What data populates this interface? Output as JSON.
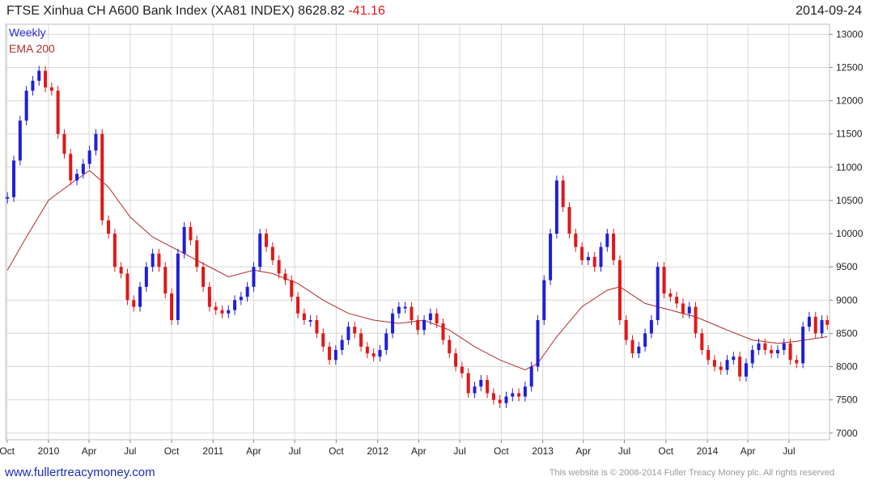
{
  "header": {
    "title": "FTSE Xinhua CH A600 Bank Index (XA81 INDEX) 8628.82",
    "change": "-41.16",
    "date": "2014-09-24"
  },
  "footer": {
    "site": "www.fullertreacymoney.com",
    "copyright": "This website is © 2008-2014 Fuller Treacy Money plc. All rights reserved"
  },
  "colors": {
    "up": "#1f1fd8",
    "down": "#e01818",
    "ema": "#b02a2a",
    "grid": "#d8d8d8"
  },
  "chart_data": {
    "type": "line",
    "legend": [
      "Weekly",
      "EMA 200"
    ],
    "legend_position": "top-left",
    "grid": true,
    "ylim": [
      6900,
      13150
    ],
    "xlim": [
      "2009-09-28",
      "2014-09-29"
    ],
    "y_ticks": [
      7000,
      7500,
      8000,
      8500,
      9000,
      9500,
      10000,
      10500,
      11000,
      11500,
      12000,
      12500,
      13000
    ],
    "x_ticks": [
      {
        "label": "Oct",
        "date": "2009-10-01"
      },
      {
        "label": "2010",
        "date": "2010-01-01"
      },
      {
        "label": "Apr",
        "date": "2010-04-01"
      },
      {
        "label": "Jul",
        "date": "2010-07-01"
      },
      {
        "label": "Oct",
        "date": "2010-10-01"
      },
      {
        "label": "2011",
        "date": "2011-01-01"
      },
      {
        "label": "Apr",
        "date": "2011-04-01"
      },
      {
        "label": "Jul",
        "date": "2011-07-01"
      },
      {
        "label": "Oct",
        "date": "2011-10-01"
      },
      {
        "label": "2012",
        "date": "2012-01-01"
      },
      {
        "label": "Apr",
        "date": "2012-04-01"
      },
      {
        "label": "Jul",
        "date": "2012-07-01"
      },
      {
        "label": "Oct",
        "date": "2012-10-01"
      },
      {
        "label": "2013",
        "date": "2013-01-01"
      },
      {
        "label": "Apr",
        "date": "2013-04-01"
      },
      {
        "label": "Jul",
        "date": "2013-07-01"
      },
      {
        "label": "Oct",
        "date": "2013-10-01"
      },
      {
        "label": "2014",
        "date": "2014-01-01"
      },
      {
        "label": "Apr",
        "date": "2014-04-01"
      },
      {
        "label": "Jul",
        "date": "2014-07-01"
      }
    ],
    "series": [
      {
        "name": "Weekly",
        "points": [
          [
            "2009-10-02",
            10550
          ],
          [
            "2009-10-16",
            11100
          ],
          [
            "2009-10-30",
            11700
          ],
          [
            "2009-11-13",
            12150
          ],
          [
            "2009-11-27",
            12300
          ],
          [
            "2009-12-11",
            12450
          ],
          [
            "2009-12-25",
            12200
          ],
          [
            "2010-01-08",
            12150
          ],
          [
            "2010-01-22",
            11500
          ],
          [
            "2010-02-05",
            11200
          ],
          [
            "2010-02-19",
            10800
          ],
          [
            "2010-03-05",
            10900
          ],
          [
            "2010-03-19",
            11050
          ],
          [
            "2010-04-02",
            11250
          ],
          [
            "2010-04-16",
            11500
          ],
          [
            "2010-04-30",
            10200
          ],
          [
            "2010-05-14",
            10000
          ],
          [
            "2010-05-28",
            9500
          ],
          [
            "2010-06-11",
            9400
          ],
          [
            "2010-06-25",
            9000
          ],
          [
            "2010-07-09",
            8900
          ],
          [
            "2010-07-23",
            9200
          ],
          [
            "2010-08-06",
            9500
          ],
          [
            "2010-08-20",
            9700
          ],
          [
            "2010-09-03",
            9500
          ],
          [
            "2010-09-17",
            9100
          ],
          [
            "2010-10-01",
            8700
          ],
          [
            "2010-10-15",
            9700
          ],
          [
            "2010-10-29",
            10100
          ],
          [
            "2010-11-12",
            9900
          ],
          [
            "2010-11-26",
            9500
          ],
          [
            "2010-12-10",
            9200
          ],
          [
            "2010-12-24",
            8900
          ],
          [
            "2011-01-07",
            8850
          ],
          [
            "2011-01-21",
            8800
          ],
          [
            "2011-02-04",
            8850
          ],
          [
            "2011-02-18",
            9000
          ],
          [
            "2011-03-04",
            9050
          ],
          [
            "2011-03-18",
            9200
          ],
          [
            "2011-04-01",
            9500
          ],
          [
            "2011-04-15",
            10000
          ],
          [
            "2011-04-29",
            9800
          ],
          [
            "2011-05-13",
            9600
          ],
          [
            "2011-05-27",
            9400
          ],
          [
            "2011-06-10",
            9300
          ],
          [
            "2011-06-24",
            9050
          ],
          [
            "2011-07-08",
            8800
          ],
          [
            "2011-07-22",
            8700
          ],
          [
            "2011-08-05",
            8700
          ],
          [
            "2011-08-19",
            8500
          ],
          [
            "2011-09-02",
            8300
          ],
          [
            "2011-09-16",
            8100
          ],
          [
            "2011-09-30",
            8250
          ],
          [
            "2011-10-14",
            8400
          ],
          [
            "2011-10-28",
            8600
          ],
          [
            "2011-11-11",
            8500
          ],
          [
            "2011-11-25",
            8300
          ],
          [
            "2011-12-09",
            8200
          ],
          [
            "2011-12-23",
            8150
          ],
          [
            "2012-01-06",
            8250
          ],
          [
            "2012-01-20",
            8500
          ],
          [
            "2012-02-03",
            8800
          ],
          [
            "2012-02-17",
            8900
          ],
          [
            "2012-03-02",
            8900
          ],
          [
            "2012-03-16",
            8700
          ],
          [
            "2012-03-30",
            8550
          ],
          [
            "2012-04-13",
            8700
          ],
          [
            "2012-04-27",
            8800
          ],
          [
            "2012-05-11",
            8650
          ],
          [
            "2012-05-25",
            8400
          ],
          [
            "2012-06-08",
            8200
          ],
          [
            "2012-06-22",
            8000
          ],
          [
            "2012-07-06",
            7900
          ],
          [
            "2012-07-20",
            7600
          ],
          [
            "2012-08-03",
            7700
          ],
          [
            "2012-08-17",
            7800
          ],
          [
            "2012-08-31",
            7600
          ],
          [
            "2012-09-14",
            7500
          ],
          [
            "2012-09-28",
            7450
          ],
          [
            "2012-10-12",
            7550
          ],
          [
            "2012-10-26",
            7600
          ],
          [
            "2012-11-09",
            7550
          ],
          [
            "2012-11-23",
            7700
          ],
          [
            "2012-12-07",
            8000
          ],
          [
            "2012-12-21",
            8700
          ],
          [
            "2013-01-04",
            9300
          ],
          [
            "2013-01-18",
            10000
          ],
          [
            "2013-02-01",
            10800
          ],
          [
            "2013-02-15",
            10400
          ],
          [
            "2013-03-01",
            10000
          ],
          [
            "2013-03-15",
            9800
          ],
          [
            "2013-03-29",
            9600
          ],
          [
            "2013-04-12",
            9650
          ],
          [
            "2013-04-26",
            9500
          ],
          [
            "2013-05-10",
            9800
          ],
          [
            "2013-05-24",
            10000
          ],
          [
            "2013-06-07",
            9600
          ],
          [
            "2013-06-21",
            8700
          ],
          [
            "2013-07-05",
            8400
          ],
          [
            "2013-07-19",
            8200
          ],
          [
            "2013-08-02",
            8300
          ],
          [
            "2013-08-16",
            8500
          ],
          [
            "2013-08-30",
            8700
          ],
          [
            "2013-09-13",
            9500
          ],
          [
            "2013-09-27",
            9100
          ],
          [
            "2013-10-11",
            9050
          ],
          [
            "2013-10-25",
            8950
          ],
          [
            "2013-11-08",
            8800
          ],
          [
            "2013-11-22",
            8900
          ],
          [
            "2013-12-06",
            8500
          ],
          [
            "2013-12-20",
            8250
          ],
          [
            "2014-01-03",
            8100
          ],
          [
            "2014-01-17",
            8000
          ],
          [
            "2014-01-31",
            7950
          ],
          [
            "2014-02-14",
            8100
          ],
          [
            "2014-02-28",
            8150
          ],
          [
            "2014-03-14",
            7850
          ],
          [
            "2014-03-28",
            8050
          ],
          [
            "2014-04-11",
            8250
          ],
          [
            "2014-04-25",
            8350
          ],
          [
            "2014-05-09",
            8250
          ],
          [
            "2014-05-23",
            8200
          ],
          [
            "2014-06-06",
            8250
          ],
          [
            "2014-06-20",
            8350
          ],
          [
            "2014-07-04",
            8100
          ],
          [
            "2014-07-18",
            8050
          ],
          [
            "2014-08-01",
            8600
          ],
          [
            "2014-08-15",
            8750
          ],
          [
            "2014-08-29",
            8500
          ],
          [
            "2014-09-12",
            8700
          ],
          [
            "2014-09-24",
            8628.82
          ]
        ]
      },
      {
        "name": "EMA 200",
        "points": [
          [
            "2009-10-02",
            9450
          ],
          [
            "2009-11-13",
            9950
          ],
          [
            "2010-01-01",
            10500
          ],
          [
            "2010-02-19",
            10750
          ],
          [
            "2010-04-02",
            10950
          ],
          [
            "2010-05-14",
            10700
          ],
          [
            "2010-07-01",
            10250
          ],
          [
            "2010-08-20",
            9950
          ],
          [
            "2010-10-15",
            9750
          ],
          [
            "2010-12-10",
            9550
          ],
          [
            "2011-02-04",
            9350
          ],
          [
            "2011-04-01",
            9450
          ],
          [
            "2011-05-13",
            9400
          ],
          [
            "2011-07-08",
            9250
          ],
          [
            "2011-09-02",
            9000
          ],
          [
            "2011-10-28",
            8800
          ],
          [
            "2011-12-23",
            8700
          ],
          [
            "2012-02-17",
            8650
          ],
          [
            "2012-04-13",
            8700
          ],
          [
            "2012-06-08",
            8550
          ],
          [
            "2012-08-03",
            8300
          ],
          [
            "2012-09-28",
            8100
          ],
          [
            "2012-11-23",
            7950
          ],
          [
            "2012-12-21",
            8050
          ],
          [
            "2013-02-01",
            8450
          ],
          [
            "2013-03-29",
            8900
          ],
          [
            "2013-05-24",
            9150
          ],
          [
            "2013-06-21",
            9200
          ],
          [
            "2013-08-16",
            8950
          ],
          [
            "2013-10-11",
            8850
          ],
          [
            "2013-12-06",
            8750
          ],
          [
            "2014-02-14",
            8550
          ],
          [
            "2014-04-11",
            8400
          ],
          [
            "2014-06-06",
            8350
          ],
          [
            "2014-07-18",
            8380
          ],
          [
            "2014-09-24",
            8450
          ]
        ]
      }
    ]
  }
}
